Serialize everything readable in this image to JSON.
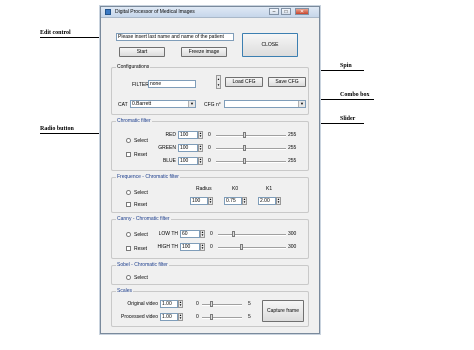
{
  "callouts": {
    "edit_control": "Edit control",
    "radio_button": "Radio button",
    "spin": "Spin",
    "combo_box": "Combo box",
    "slider": "Slider"
  },
  "window": {
    "title": "Digital Processor of Medical Images",
    "minimize": "–",
    "maximize": "□",
    "close": "✕"
  },
  "top": {
    "name_field_value": "Please insert last name and name of the patient",
    "start_label": "Start",
    "freeze_label": "Freeze image",
    "close_label": "CLOSE"
  },
  "configurations": {
    "title": "Configurations",
    "filter_label": "FILTER",
    "filter_value": "none",
    "load_label": "Load CFG",
    "save_label": "Save CFG",
    "cat_label": "CAT",
    "cat_value": "0.Barrett",
    "cfg_label": "CFG n°",
    "cfg_value": ""
  },
  "chromatic": {
    "title": "Chromatic filter",
    "select_label": "Select",
    "reset_label": "Reset",
    "rows": [
      {
        "label": "RED",
        "value": "100",
        "min": "0",
        "max": "255",
        "level": 0.39
      },
      {
        "label": "GREEN",
        "value": "100",
        "min": "0",
        "max": "255",
        "level": 0.39
      },
      {
        "label": "BLUE",
        "value": "100",
        "min": "0",
        "max": "255",
        "level": 0.39
      }
    ]
  },
  "frequency": {
    "title": "Frequence - Chromatic filter",
    "select_label": "Select",
    "reset_label": "Reset",
    "radius_label": "Radius",
    "k0_label": "K0",
    "k1_label": "K1",
    "radius_value": "100",
    "k0_value": "0.75",
    "k1_value": "2.00"
  },
  "canny": {
    "title": "Canny - Chromatic filter",
    "select_label": "Select",
    "reset_label": "Reset",
    "rows": [
      {
        "label": "LOW TH",
        "value": "60",
        "min": "0",
        "max": "300",
        "level": 0.2
      },
      {
        "label": "HIGH TH",
        "value": "100",
        "min": "0",
        "max": "300",
        "level": 0.33
      }
    ]
  },
  "sobel": {
    "title": "Sobel - Chromatic filter",
    "select_label": "Select"
  },
  "scales": {
    "title": "Scales",
    "rows": [
      {
        "label": "Original video",
        "value": "1.00",
        "min": "0",
        "max": "5",
        "level": 0.2
      },
      {
        "label": "Processed video",
        "value": "1.00",
        "min": "0",
        "max": "5",
        "level": 0.2
      }
    ],
    "capture_label": "Capture frame"
  }
}
